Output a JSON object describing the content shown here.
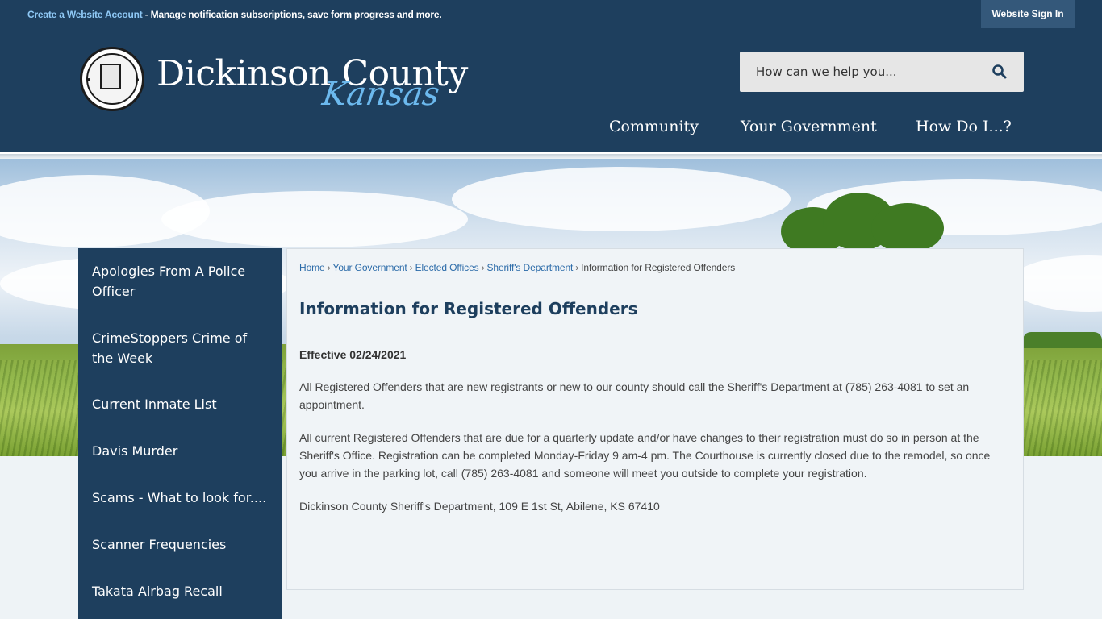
{
  "topbar": {
    "create_account": "Create a Website Account",
    "message": " - Manage notification subscriptions, save form progress and more.",
    "sign_in": "Website Sign In"
  },
  "header": {
    "logo_main": "Dickinson County",
    "logo_script": "Kansas",
    "search_placeholder": "How can we help you...",
    "nav": [
      "Community",
      "Your Government",
      "How Do I...?"
    ]
  },
  "sidebar": {
    "items": [
      "Apologies From A Police Officer",
      "CrimeStoppers Crime of the Week",
      "Current Inmate List",
      "Davis Murder",
      "Scams - What to look for....",
      "Scanner Frequencies",
      "Takata Airbag Recall"
    ]
  },
  "breadcrumb": {
    "links": [
      "Home",
      "Your Government",
      "Elected Offices",
      "Sheriff's Department"
    ],
    "separator": "›",
    "current": "Information for Registered Offenders"
  },
  "page": {
    "title": "Information for Registered Offenders",
    "effective": "Effective 02/24/2021",
    "paragraph1": "All Registered Offenders that are new registrants or new to our county should call the Sheriff's Department at (785) 263-4081 to set an appointment.",
    "paragraph2": "All current Registered Offenders that are due for a quarterly update and/or have changes to their registration must do so in person at the Sheriff's Office. Registration can be completed Monday-Friday 9 am-4 pm. The Courthouse is currently closed due to the remodel, so once you arrive in the parking lot, call (785) 263-4081 and someone will meet you outside to complete your registration.",
    "address": "Dickinson County Sheriff's Department, 109 E 1st St, Abilene, KS  67410"
  },
  "colors": {
    "brand_navy": "#1e3f5e",
    "link_blue": "#2a6aa8",
    "logo_accent": "#6cb9ee"
  }
}
